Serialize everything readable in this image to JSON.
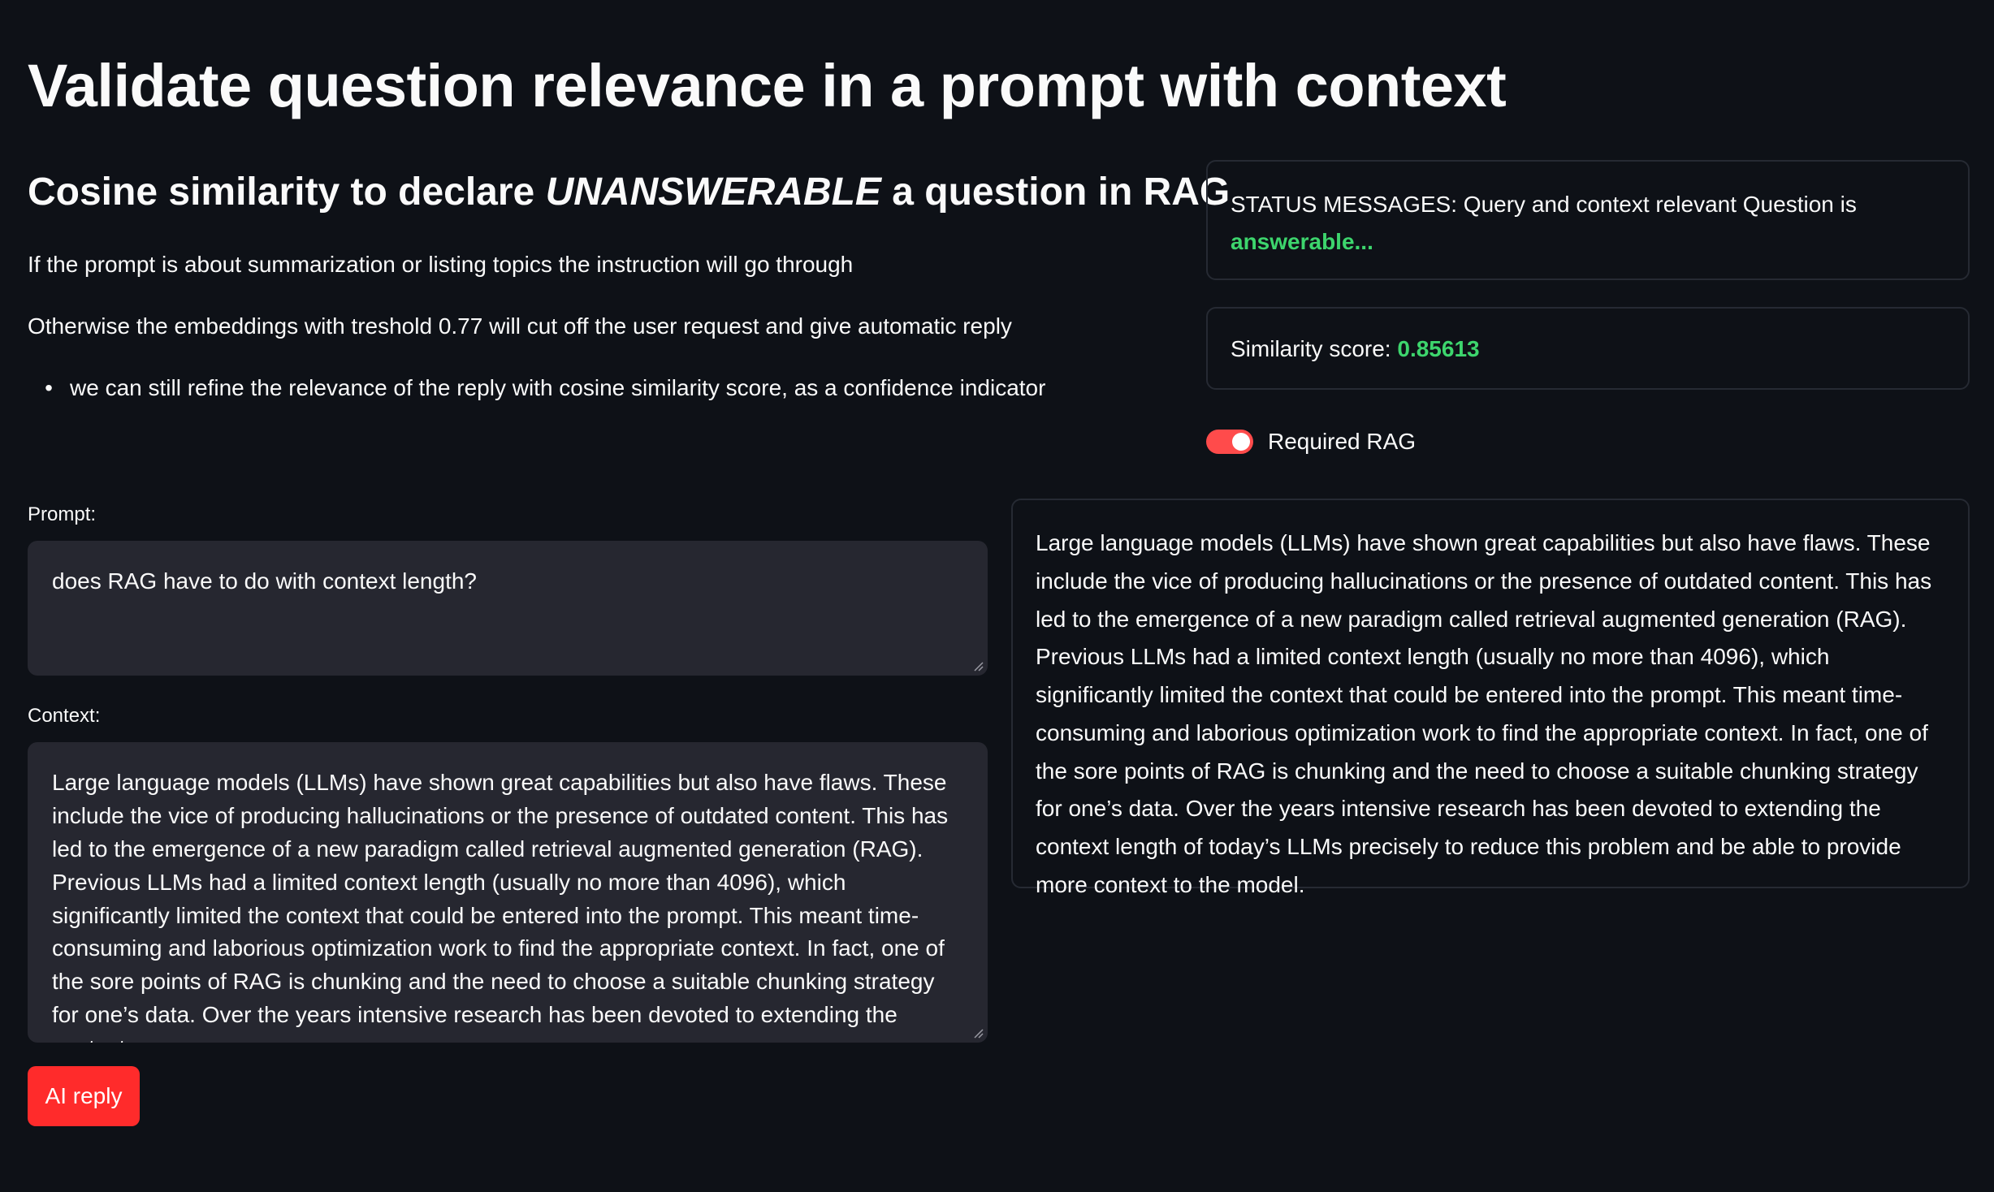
{
  "header": {
    "title": "Validate question relevance in a prompt with context",
    "subtitle_prefix": "Cosine similarity to declare ",
    "subtitle_emphasis": "UNANSWERABLE",
    "subtitle_suffix": " a question in RAG"
  },
  "intro": {
    "line1": "If the prompt is about summarization or listing topics the instruction will go through",
    "line2": "Otherwise the embeddings with treshold 0.77 will cut off the user request and give automatic reply",
    "bullet": "we can still refine the relevance of the reply with cosine similarity score, as a confidence indicator"
  },
  "status": {
    "prefix": "STATUS MESSAGES: Query and context relevant Question is",
    "highlight": "answerable..."
  },
  "similarity": {
    "label": "Similarity score: ",
    "value": "0.85613"
  },
  "toggle": {
    "label": "Required RAG",
    "on": true
  },
  "prompt": {
    "label": "Prompt:",
    "value": "does RAG have to do with context length?"
  },
  "context": {
    "label": "Context:",
    "value": "Large language models (LLMs) have shown great capabilities but also have flaws. These include the vice of producing hallucinations or the presence of outdated content. This has led to the emergence of a new paradigm called retrieval augmented generation (RAG). Previous LLMs had a limited context length (usually no more than 4096), which significantly limited the context that could be entered into the prompt. This meant time-consuming and laborious optimization work to find the appropriate context. In fact, one of the sore points of RAG is chunking and the need to choose a suitable chunking strategy for one’s data. Over the years intensive research has been devoted to extending the context"
  },
  "reply": {
    "text": "Large language models (LLMs) have shown great capabilities but also have flaws. These include the vice of producing hallucinations or the presence of outdated content. This has led to the emergence of a new paradigm called retrieval augmented generation (RAG). Previous LLMs had a limited context length (usually no more than 4096), which significantly limited the context that could be entered into the prompt. This meant time-consuming and laborious optimization work to find the appropriate context. In fact, one of the sore points of RAG is chunking and the need to choose a suitable chunking strategy for one’s data. Over the years intensive research has been devoted to extending the context length of today’s LLMs precisely to reduce this problem and be able to provide more context to the model."
  },
  "button": {
    "label": "AI reply"
  },
  "colors": {
    "background": "#0e1117",
    "accent": "#ff4b4b",
    "success": "#3dd56d",
    "input_bg": "#262730"
  }
}
